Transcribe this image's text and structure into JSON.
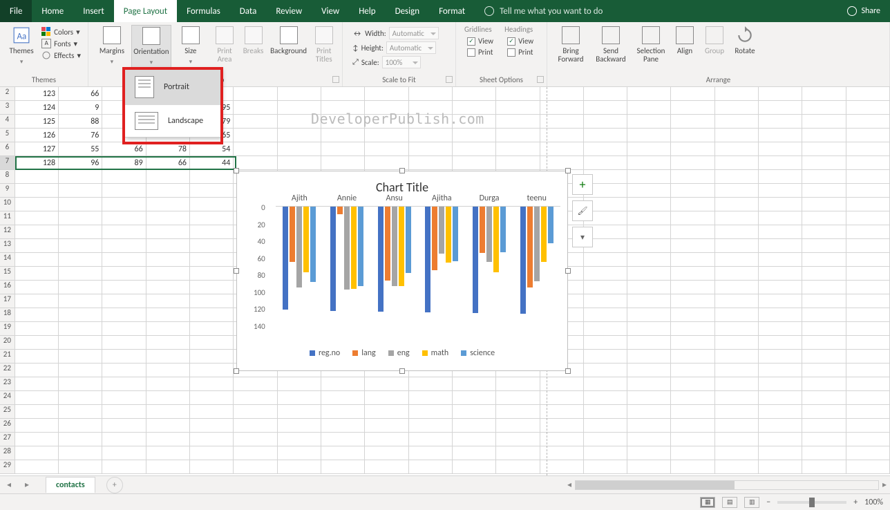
{
  "tabs": {
    "file": "File",
    "home": "Home",
    "insert": "Insert",
    "page_layout": "Page Layout",
    "formulas": "Formulas",
    "data": "Data",
    "review": "Review",
    "view": "View",
    "help": "Help",
    "design": "Design",
    "format": "Format",
    "tell_me": "Tell me what you want to do",
    "share": "Share"
  },
  "ribbon": {
    "themes": {
      "label": "Themes",
      "btn": "Themes",
      "colors": "Colors",
      "fonts": "Fonts",
      "effects": "Effects"
    },
    "page_setup": {
      "label": "Setup",
      "margins": "Margins",
      "orientation": "Orientation",
      "size": "Size",
      "print_area": "Print Area",
      "breaks": "Breaks",
      "background": "Background",
      "print_titles": "Print Titles"
    },
    "scale": {
      "label": "Scale to Fit",
      "width": "Width:",
      "height": "Height:",
      "scale": "Scale:",
      "width_val": "Automatic",
      "height_val": "Automatic",
      "scale_val": "100%"
    },
    "sheet_opts": {
      "label": "Sheet Options",
      "gridlines": "Gridlines",
      "headings": "Headings",
      "view": "View",
      "print": "Print"
    },
    "arrange": {
      "label": "Arrange",
      "bring": "Bring Forward",
      "send": "Send Backward",
      "selpane": "Selection Pane",
      "align": "Align",
      "group": "Group",
      "rotate": "Rotate"
    }
  },
  "orientation_menu": {
    "portrait": "Portrait",
    "landscape": "Landscape"
  },
  "grid": {
    "rows": [
      {
        "n": 2,
        "cells": [
          "123",
          "66",
          "",
          "",
          ""
        ]
      },
      {
        "n": 3,
        "cells": [
          "124",
          "9",
          "",
          "",
          "95"
        ]
      },
      {
        "n": 4,
        "cells": [
          "125",
          "88",
          "",
          "",
          "79"
        ]
      },
      {
        "n": 5,
        "cells": [
          "126",
          "76",
          "",
          "",
          "65"
        ]
      },
      {
        "n": 6,
        "cells": [
          "127",
          "55",
          "66",
          "78",
          "54"
        ]
      },
      {
        "n": 7,
        "cells": [
          "128",
          "96",
          "89",
          "66",
          "44"
        ]
      }
    ],
    "empty_rows": [
      8,
      9,
      10,
      11,
      12,
      13,
      14,
      15,
      16,
      17,
      18,
      19,
      20,
      21,
      22,
      23,
      24,
      25,
      26,
      27,
      28,
      29
    ]
  },
  "watermark": "DeveloperPublish.com",
  "chart_data": {
    "type": "bar",
    "title": "Chart Title",
    "orientation": "hanging",
    "categories": [
      "Ajith",
      "Annie",
      "Ansu",
      "Ajitha",
      "Durga",
      "teenu"
    ],
    "series": [
      {
        "name": "reg.no",
        "color": "#4472c4",
        "values": [
          123,
          124,
          125,
          126,
          127,
          128
        ]
      },
      {
        "name": "lang",
        "color": "#ed7d31",
        "values": [
          66,
          9,
          88,
          76,
          55,
          96
        ]
      },
      {
        "name": "eng",
        "color": "#a5a5a5",
        "values": [
          96,
          99,
          95,
          56,
          66,
          89
        ]
      },
      {
        "name": "math",
        "color": "#ffc000",
        "values": [
          78,
          98,
          95,
          67,
          78,
          66
        ]
      },
      {
        "name": "science",
        "color": "#5b9bd5",
        "values": [
          90,
          95,
          79,
          65,
          54,
          44
        ]
      }
    ],
    "ylim": [
      0,
      140
    ],
    "yticks": [
      0,
      20,
      40,
      60,
      80,
      100,
      120,
      140
    ]
  },
  "sheet_tab": "contacts",
  "zoom": "100%"
}
